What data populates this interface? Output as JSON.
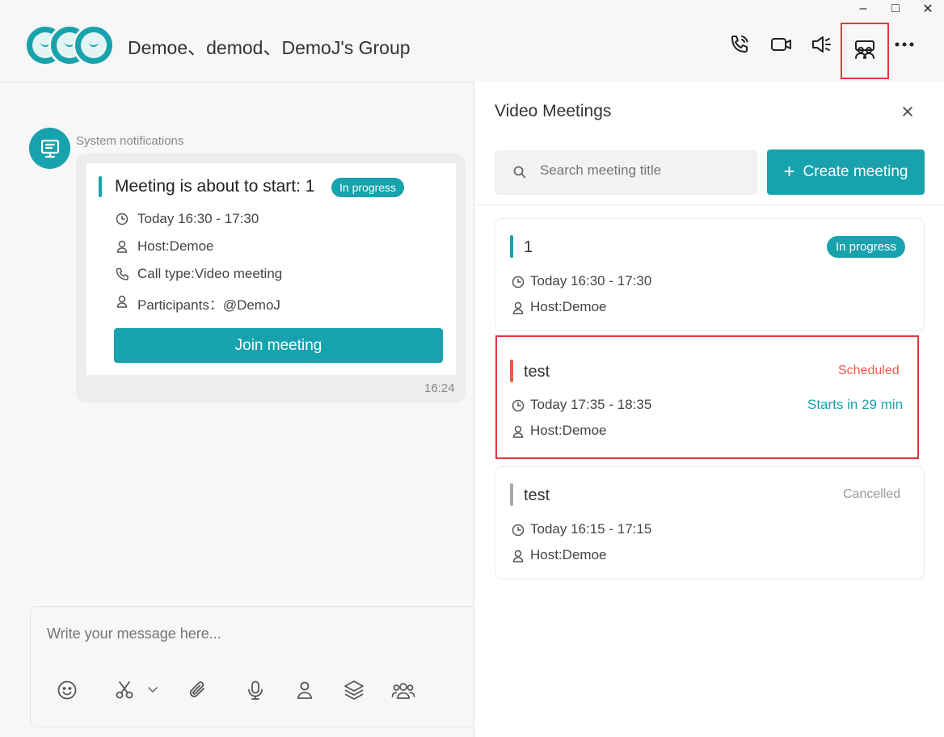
{
  "window": {
    "minimize": "–",
    "maximize": "□",
    "close": "✕"
  },
  "header": {
    "group_name": "Demoe、demod、DemoJ's Group",
    "icons": [
      "phone-icon",
      "video-camera-icon",
      "speaker-icon",
      "meetings-icon",
      "more-icon"
    ]
  },
  "chat": {
    "system_label": "System notifications",
    "message": {
      "title": "Meeting is about to start: 1",
      "status": "In progress",
      "time": "Today 16:30 - 17:30",
      "host": "Host:Demoe",
      "call_type": "Call type:Video meeting",
      "participants": "Participants：@DemoJ",
      "join_label": "Join meeting",
      "timestamp": "16:24"
    }
  },
  "composer": {
    "placeholder": "Write your message here...",
    "tools": [
      "emoji-icon",
      "scissors-icon",
      "chevron-down-icon",
      "paperclip-icon",
      "microphone-icon",
      "contact-icon",
      "layers-icon",
      "group-icon"
    ]
  },
  "panel": {
    "title": "Video Meetings",
    "search_placeholder": "Search meeting title",
    "create_label": "Create meeting",
    "create_plus": "+",
    "meetings": [
      {
        "title": "1",
        "status": "In progress",
        "time": "Today 16:30 - 17:30",
        "host": "Host:Demoe",
        "note": "",
        "bar_color": "#17a2ad"
      },
      {
        "title": "test",
        "status": "Scheduled",
        "time": "Today 17:35 - 18:35",
        "host": "Host:Demoe",
        "note": "Starts in 29 min",
        "bar_color": "#ee5a48"
      },
      {
        "title": "test",
        "status": "Cancelled",
        "time": "Today 16:15 - 17:15",
        "host": "Host:Demoe",
        "note": "",
        "bar_color": "#a8a8a8"
      }
    ]
  },
  "colors": {
    "accent": "#17a2ad",
    "scheduled": "#ee5a48",
    "cancelled": "#999999",
    "highlight": "#e0383e"
  }
}
